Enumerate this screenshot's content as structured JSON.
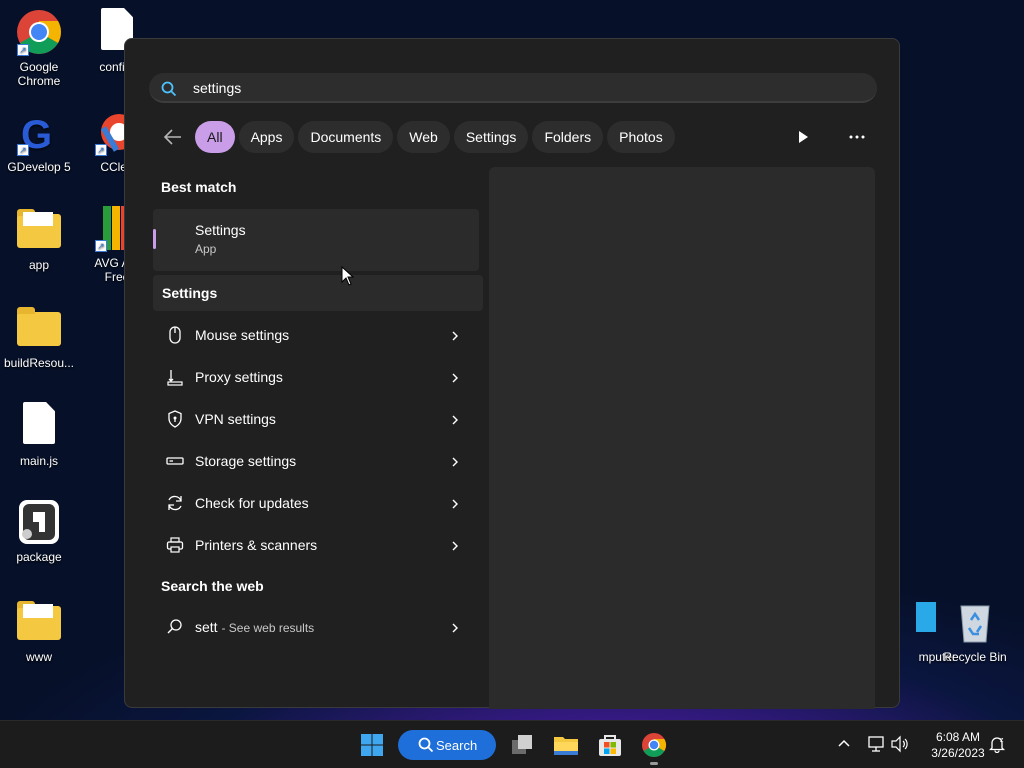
{
  "desktop": {
    "icons": [
      {
        "label": "Google\nChrome",
        "icon": "chrome-icon"
      },
      {
        "label": "config.",
        "icon": "file-icon"
      },
      {
        "label": "GDevelop 5",
        "icon": "gdevelop-icon"
      },
      {
        "label": "CClea",
        "icon": "ccleaner-icon"
      },
      {
        "label": "app",
        "icon": "folder-icon"
      },
      {
        "label": "AVG Ant\nFree",
        "icon": "avg-icon"
      },
      {
        "label": "buildResou...",
        "icon": "folder-icon"
      },
      {
        "label": "main.js",
        "icon": "file-icon"
      },
      {
        "label": "package",
        "icon": "package-icon"
      },
      {
        "label": "www",
        "icon": "folder-icon"
      },
      {
        "label": "mputer",
        "icon": "computer-icon"
      },
      {
        "label": "Recycle Bin",
        "icon": "recycle-bin-icon"
      }
    ]
  },
  "search": {
    "value": "settings"
  },
  "filters": [
    "All",
    "Apps",
    "Documents",
    "Web",
    "Settings",
    "Folders",
    "Photos"
  ],
  "active_filter": "All",
  "results": {
    "best_match_title": "Best match",
    "best_match": {
      "name": "Settings",
      "type": "App"
    },
    "settings_title": "Settings",
    "settings_items": [
      {
        "label": "Mouse settings",
        "icon": "mouse-icon"
      },
      {
        "label": "Proxy settings",
        "icon": "proxy-icon"
      },
      {
        "label": "VPN settings",
        "icon": "vpn-shield-icon"
      },
      {
        "label": "Storage settings",
        "icon": "storage-icon"
      },
      {
        "label": "Check for updates",
        "icon": "update-icon"
      },
      {
        "label": "Printers & scanners",
        "icon": "printer-icon"
      }
    ],
    "web_title": "Search the web",
    "web_item": {
      "query": "sett",
      "suffix": "- See web results"
    }
  },
  "taskbar": {
    "search_label": "Search",
    "time": "6:08 AM",
    "date": "3/26/2023"
  },
  "colors": {
    "accent": "#c99de8",
    "panel": "#202020",
    "taskbar_search": "#1e6fd9"
  }
}
